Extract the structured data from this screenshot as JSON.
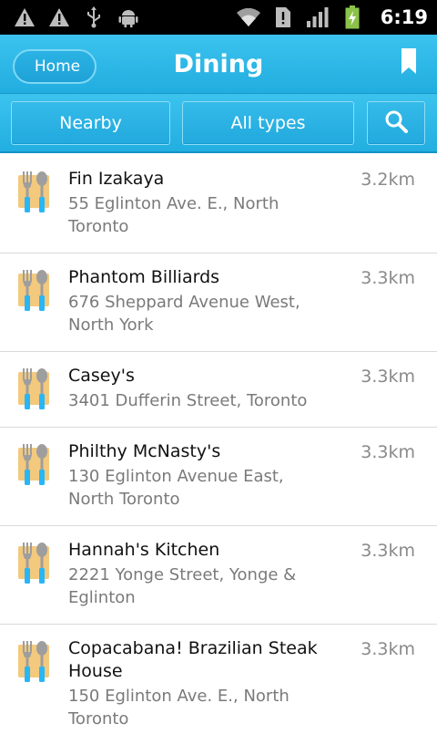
{
  "status_bar": {
    "time": "6:19",
    "left_icons": [
      "warning-icon",
      "warning-icon",
      "usb-icon",
      "android-debug-icon"
    ],
    "right_icons": [
      "wifi-icon",
      "no-sim-icon",
      "signal-icon",
      "battery-charging-icon"
    ]
  },
  "header": {
    "home_label": "Home",
    "title": "Dining",
    "bookmark_icon": "bookmark-icon"
  },
  "filters": {
    "nearby_label": "Nearby",
    "types_label": "All types",
    "search_icon": "search-icon"
  },
  "colors": {
    "header_blue": "#2db6e6",
    "title_text": "#ffffff",
    "distance_text": "#8a8a8a"
  },
  "places": [
    {
      "name": "Fin Izakaya",
      "address": "55 Eglinton Ave. E., North Toronto",
      "distance": "3.2km"
    },
    {
      "name": "Phantom Billiards",
      "address": "676 Sheppard Avenue West, North York",
      "distance": "3.3km"
    },
    {
      "name": "Casey's",
      "address": "3401 Dufferin Street, Toronto",
      "distance": "3.3km"
    },
    {
      "name": "Philthy McNasty's",
      "address": "130 Eglinton Avenue East, North Toronto",
      "distance": "3.3km"
    },
    {
      "name": "Hannah's Kitchen",
      "address": "2221 Yonge Street, Yonge & Eglinton",
      "distance": "3.3km"
    },
    {
      "name": "Copacabana! Brazilian Steak House",
      "address": "150 Eglinton Ave. E., North Toronto",
      "distance": "3.3km"
    }
  ]
}
